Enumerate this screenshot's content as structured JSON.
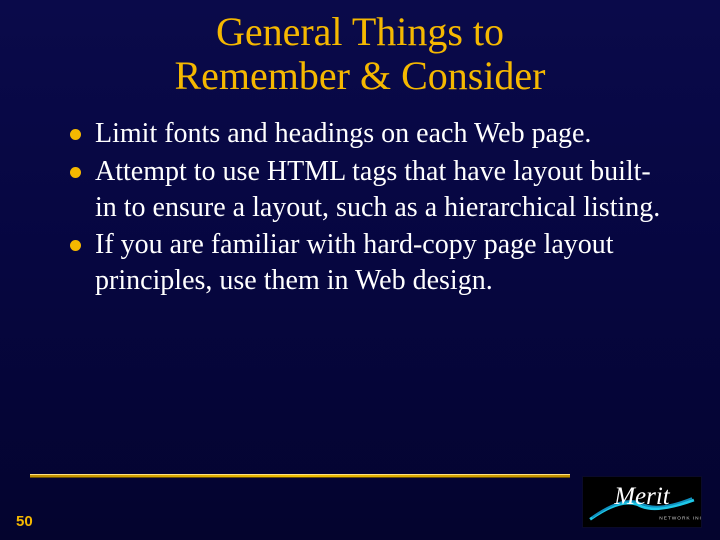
{
  "title_line1": "General Things to",
  "title_line2": "Remember & Consider",
  "bullets": [
    "Limit fonts and headings on each Web page.",
    "Attempt to use HTML tags that have layout built-in to ensure a layout, such as a hierarchical listing.",
    "If you are familiar with hard-copy page layout principles, use them in Web design."
  ],
  "page_number": "50",
  "logo_text": "Merit"
}
